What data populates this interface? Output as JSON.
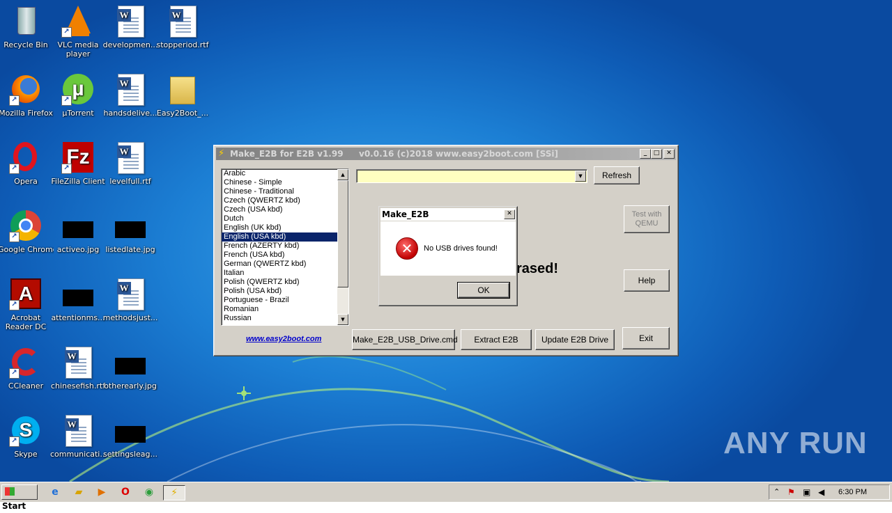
{
  "desktop": {
    "icons": [
      {
        "label": "Recycle Bin",
        "type": "recycle-bin"
      },
      {
        "label": "VLC media player",
        "type": "vlc"
      },
      {
        "label": "developmen...",
        "type": "word-doc"
      },
      {
        "label": "stopperiod.rtf",
        "type": "word-doc"
      },
      {
        "label": "Mozilla Firefox",
        "type": "firefox"
      },
      {
        "label": "µTorrent",
        "type": "utorrent"
      },
      {
        "label": "handsdelive...",
        "type": "word-doc"
      },
      {
        "label": "Easy2Boot_...",
        "type": "folder"
      },
      {
        "label": "Opera",
        "type": "opera"
      },
      {
        "label": "FileZilla Client",
        "type": "filezilla"
      },
      {
        "label": "levelfull.rtf",
        "type": "word-doc"
      },
      {
        "label": "Google Chrome",
        "type": "chrome"
      },
      {
        "label": "activeo.jpg",
        "type": "image"
      },
      {
        "label": "listedlate.jpg",
        "type": "image"
      },
      {
        "label": "Acrobat Reader DC",
        "type": "acrobat"
      },
      {
        "label": "attentionms...",
        "type": "image"
      },
      {
        "label": "methodsjust...",
        "type": "word-doc"
      },
      {
        "label": "CCleaner",
        "type": "ccleaner"
      },
      {
        "label": "chinesefish.rtf",
        "type": "word-doc"
      },
      {
        "label": "otherearly.jpg",
        "type": "image"
      },
      {
        "label": "Skype",
        "type": "skype"
      },
      {
        "label": "communicati...",
        "type": "word-doc"
      },
      {
        "label": "settingsleag...",
        "type": "image"
      }
    ],
    "watermark": "ANY RUN"
  },
  "window": {
    "title": "Make_E2B for E2B v1.99",
    "title_info": "v0.0.16  (c)2018 www.easy2boot.com [SSi]",
    "languages": [
      "Arabic",
      "Chinese - Simple",
      "Chinese - Traditional",
      "Czech  (QWERTZ kbd)",
      "Czech  (USA kbd)",
      "Dutch",
      "English  (UK kbd)",
      "English  (USA kbd)",
      "French  (AZERTY kbd)",
      "French  (USA kbd)",
      "German  (QWERTZ kbd)",
      "Italian",
      "Polish  (QWERTZ kbd)",
      "Polish  (USA kbd)",
      "Portuguese - Brazil",
      "Romanian",
      "Russian"
    ],
    "selected_language": "English  (USA kbd)",
    "drive_combo_value": "",
    "refresh_label": "Refresh",
    "test_qemu_label": "Test with QEMU",
    "help_label": "Help",
    "erased_text": "rased!",
    "link_text": "www.easy2boot.com",
    "make_cmd_label": "Make_E2B_USB_Drive.cmd",
    "extract_label": "Extract E2B",
    "update_label": "Update E2B Drive",
    "exit_label": "Exit"
  },
  "dialog": {
    "title": "Make_E2B",
    "message": "No USB drives found!",
    "ok_label": "OK"
  },
  "taskbar": {
    "start_label": "Start",
    "clock": "6:30 PM",
    "pinned": [
      "internet-explorer-icon",
      "explorer-icon",
      "media-player-icon",
      "opera-icon",
      "chrome-icon",
      "make-e2b-icon"
    ]
  }
}
